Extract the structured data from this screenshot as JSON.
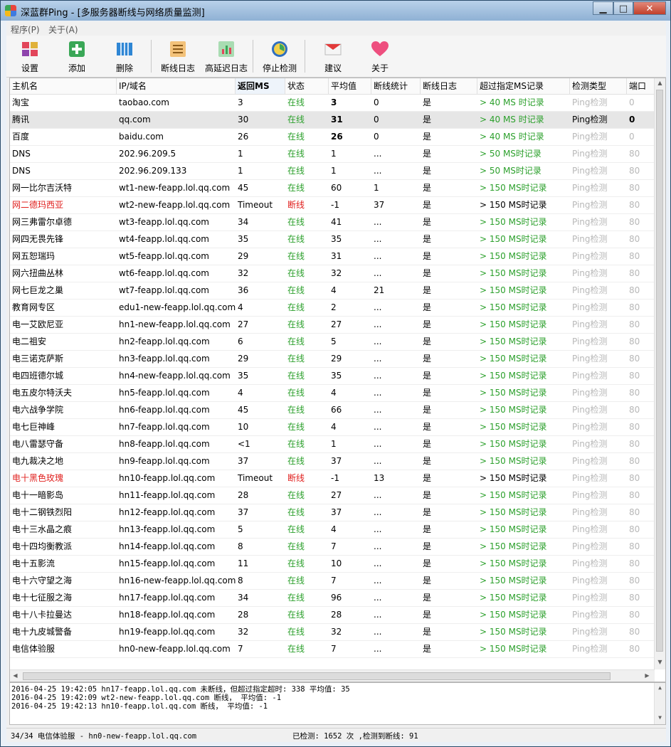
{
  "window": {
    "title": "深蓝群Ping - [多服务器断线与网络质量监测]",
    "min_glyph": "▁",
    "max_glyph": "□",
    "close_glyph": "✕"
  },
  "menu": [
    {
      "label": "程序(P)"
    },
    {
      "label": "关于(A)"
    }
  ],
  "toolbar": [
    {
      "label": "设置",
      "icon": "settings-icon"
    },
    {
      "label": "添加",
      "icon": "add-icon"
    },
    {
      "label": "删除",
      "icon": "delete-icon"
    },
    {
      "label": "断线日志",
      "icon": "disconnect-log-icon"
    },
    {
      "label": "高延迟日志",
      "icon": "high-latency-log-icon"
    },
    {
      "label": "停止检测",
      "icon": "stop-detect-icon"
    },
    {
      "label": "建议",
      "icon": "suggestion-mail-icon"
    },
    {
      "label": "关于",
      "icon": "about-heart-icon"
    }
  ],
  "columns": [
    "主机名",
    "IP/域名",
    "返回MS",
    "状态",
    "平均值",
    "断线统计",
    "断线日志",
    "超过指定MS记录",
    "检测类型",
    "端口"
  ],
  "colors": {
    "online": "#2ca02c",
    "offline": "#e0201e",
    "disabled": "#b8b8b8"
  },
  "rows": [
    [
      "淘宝",
      "taobao.com",
      "3",
      "在线",
      "3",
      "0",
      "是",
      "> 40 MS 时记录",
      "Ping检测",
      "0"
    ],
    [
      "腾讯",
      "qq.com",
      "30",
      "在线",
      "31",
      "0",
      "是",
      "> 40 MS 时记录",
      "Ping检测",
      "0"
    ],
    [
      "百度",
      "baidu.com",
      "26",
      "在线",
      "26",
      "0",
      "是",
      "> 40 MS 时记录",
      "Ping检测",
      "0"
    ],
    [
      "DNS",
      "202.96.209.5",
      "1",
      "在线",
      "1",
      "...",
      "是",
      "> 50 MS时记录",
      "Ping检测",
      "80"
    ],
    [
      "DNS",
      "202.96.209.133",
      "1",
      "在线",
      "1",
      "...",
      "是",
      "> 50 MS时记录",
      "Ping检测",
      "80"
    ],
    [
      "网一比尔吉沃特",
      "wt1-new-feapp.lol.qq.com",
      "45",
      "在线",
      "60",
      "1",
      "是",
      "> 150 MS时记录",
      "Ping检测",
      "80"
    ],
    [
      "网二德玛西亚",
      "wt2-new-feapp.lol.qq.com",
      "Timeout",
      "断线",
      "-1",
      "37",
      "是",
      "> 150 MS时记录",
      "Ping检测",
      "80"
    ],
    [
      "网三弗雷尔卓德",
      "wt3-feapp.lol.qq.com",
      "34",
      "在线",
      "41",
      "...",
      "是",
      "> 150 MS时记录",
      "Ping检测",
      "80"
    ],
    [
      "网四无畏先锋",
      "wt4-feapp.lol.qq.com",
      "35",
      "在线",
      "35",
      "...",
      "是",
      "> 150 MS时记录",
      "Ping检测",
      "80"
    ],
    [
      "网五恕瑞玛",
      "wt5-feapp.lol.qq.com",
      "29",
      "在线",
      "31",
      "...",
      "是",
      "> 150 MS时记录",
      "Ping检测",
      "80"
    ],
    [
      "网六扭曲丛林",
      "wt6-feapp.lol.qq.com",
      "32",
      "在线",
      "32",
      "...",
      "是",
      "> 150 MS时记录",
      "Ping检测",
      "80"
    ],
    [
      "网七巨龙之巢",
      "wt7-feapp.lol.qq.com",
      "36",
      "在线",
      "4",
      "21",
      "是",
      "> 150 MS时记录",
      "Ping检测",
      "80"
    ],
    [
      "教育网专区",
      "edu1-new-feapp.lol.qq.com",
      "4",
      "在线",
      "2",
      "...",
      "是",
      "> 150 MS时记录",
      "Ping检测",
      "80"
    ],
    [
      "电一艾欧尼亚",
      "hn1-new-feapp.lol.qq.com",
      "27",
      "在线",
      "27",
      "...",
      "是",
      "> 150 MS时记录",
      "Ping检测",
      "80"
    ],
    [
      "电二祖安",
      "hn2-feapp.lol.qq.com",
      "6",
      "在线",
      "5",
      "...",
      "是",
      "> 150 MS时记录",
      "Ping检测",
      "80"
    ],
    [
      "电三诺克萨斯",
      "hn3-feapp.lol.qq.com",
      "29",
      "在线",
      "29",
      "...",
      "是",
      "> 150 MS时记录",
      "Ping检测",
      "80"
    ],
    [
      "电四班德尔城",
      "hn4-new-feapp.lol.qq.com",
      "35",
      "在线",
      "35",
      "...",
      "是",
      "> 150 MS时记录",
      "Ping检测",
      "80"
    ],
    [
      "电五皮尔特沃夫",
      "hn5-feapp.lol.qq.com",
      "4",
      "在线",
      "4",
      "...",
      "是",
      "> 150 MS时记录",
      "Ping检测",
      "80"
    ],
    [
      "电六战争学院",
      "hn6-feapp.lol.qq.com",
      "45",
      "在线",
      "66",
      "...",
      "是",
      "> 150 MS时记录",
      "Ping检测",
      "80"
    ],
    [
      "电七巨神峰",
      "hn7-feapp.lol.qq.com",
      "10",
      "在线",
      "4",
      "...",
      "是",
      "> 150 MS时记录",
      "Ping检测",
      "80"
    ],
    [
      "电八雷瑟守备",
      "hn8-feapp.lol.qq.com",
      "<1",
      "在线",
      "1",
      "...",
      "是",
      "> 150 MS时记录",
      "Ping检测",
      "80"
    ],
    [
      "电九裁决之地",
      "hn9-feapp.lol.qq.com",
      "37",
      "在线",
      "37",
      "...",
      "是",
      "> 150 MS时记录",
      "Ping检测",
      "80"
    ],
    [
      "电十黑色玫瑰",
      "hn10-feapp.lol.qq.com",
      "Timeout",
      "断线",
      "-1",
      "13",
      "是",
      "> 150 MS时记录",
      "Ping检测",
      "80"
    ],
    [
      "电十一暗影岛",
      "hn11-feapp.lol.qq.com",
      "28",
      "在线",
      "27",
      "...",
      "是",
      "> 150 MS时记录",
      "Ping检测",
      "80"
    ],
    [
      "电十二钢铁烈阳",
      "hn12-feapp.lol.qq.com",
      "37",
      "在线",
      "37",
      "...",
      "是",
      "> 150 MS时记录",
      "Ping检测",
      "80"
    ],
    [
      "电十三水晶之痕",
      "hn13-feapp.lol.qq.com",
      "5",
      "在线",
      "4",
      "...",
      "是",
      "> 150 MS时记录",
      "Ping检测",
      "80"
    ],
    [
      "电十四均衡教派",
      "hn14-feapp.lol.qq.com",
      "8",
      "在线",
      "7",
      "...",
      "是",
      "> 150 MS时记录",
      "Ping检测",
      "80"
    ],
    [
      "电十五影流",
      "hn15-feapp.lol.qq.com",
      "11",
      "在线",
      "10",
      "...",
      "是",
      "> 150 MS时记录",
      "Ping检测",
      "80"
    ],
    [
      "电十六守望之海",
      "hn16-new-feapp.lol.qq.com",
      "8",
      "在线",
      "7",
      "...",
      "是",
      "> 150 MS时记录",
      "Ping检测",
      "80"
    ],
    [
      "电十七征服之海",
      "hn17-feapp.lol.qq.com",
      "34",
      "在线",
      "96",
      "...",
      "是",
      "> 150 MS时记录",
      "Ping检测",
      "80"
    ],
    [
      "电十八卡拉曼达",
      "hn18-feapp.lol.qq.com",
      "28",
      "在线",
      "28",
      "...",
      "是",
      "> 150 MS时记录",
      "Ping检测",
      "80"
    ],
    [
      "电十九皮城警备",
      "hn19-feapp.lol.qq.com",
      "32",
      "在线",
      "32",
      "...",
      "是",
      "> 150 MS时记录",
      "Ping检测",
      "80"
    ],
    [
      "电信体验服",
      "hn0-new-feapp.lol.qq.com",
      "7",
      "在线",
      "7",
      "...",
      "是",
      "> 150 MS时记录",
      "Ping检测",
      "80"
    ]
  ],
  "log": [
    "2016-04-25 19:42:05 hn17-feapp.lol.qq.com 未断线，但超过指定超时: 338 平均值: 35",
    "2016-04-25 19:42:09 wt2-new-feapp.lol.qq.com 断线，  平均值: -1",
    "2016-04-25 19:42:13 hn10-feapp.lol.qq.com 断线，  平均值: -1"
  ],
  "status": {
    "current": "34/34 电信体验服 - hn0-new-feapp.lol.qq.com",
    "summary": "已检测: 1652 次 ,检测到断线: 91"
  }
}
